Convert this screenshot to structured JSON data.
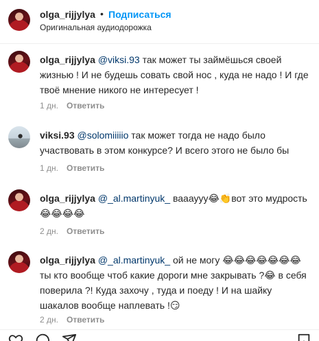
{
  "header": {
    "username": "olga_rijjylya",
    "dot": "•",
    "follow_label": "Подписаться",
    "audio_label": "Оригинальная аудиодорожка"
  },
  "comments": [
    {
      "username": "olga_rijjylya",
      "mention": "@viksi.93",
      "text": " так может ты займёшься своей жизнью ! И не будешь совать свой нос , куда не надо ! И где твоё мнение никого не интересует !",
      "time": "1 дн.",
      "reply_label": "Ответить"
    },
    {
      "username": "viksi.93",
      "mention": "@solomiiiiio",
      "text": " так может тогда не надо было участвовать в этом конкурсе? И всего этого не было бы",
      "time": "1 дн.",
      "reply_label": "Ответить"
    },
    {
      "username": "olga_rijjylya",
      "mention": "@_al.martinyuk_",
      "text": " вааауyy😂👏вот это мудрость 😂😂😂😂",
      "time": "2 дн.",
      "reply_label": "Ответить"
    },
    {
      "username": "olga_rijjylya",
      "mention": "@_al.martinyuk_",
      "text": " ой не могу 😂😂😂😂😂😂😂 ты кто вообще чтоб какие дороги мне закрывать ?😂 в себя поверила ?! Куда захочу , туда и поеду ! И на шайку шакалов вообще наплевать !😏",
      "time": "2 дн.",
      "reply_label": "Ответить"
    }
  ],
  "footer": {
    "icons": [
      "heart-icon",
      "comment-icon",
      "share-icon",
      "bookmark-icon"
    ]
  }
}
